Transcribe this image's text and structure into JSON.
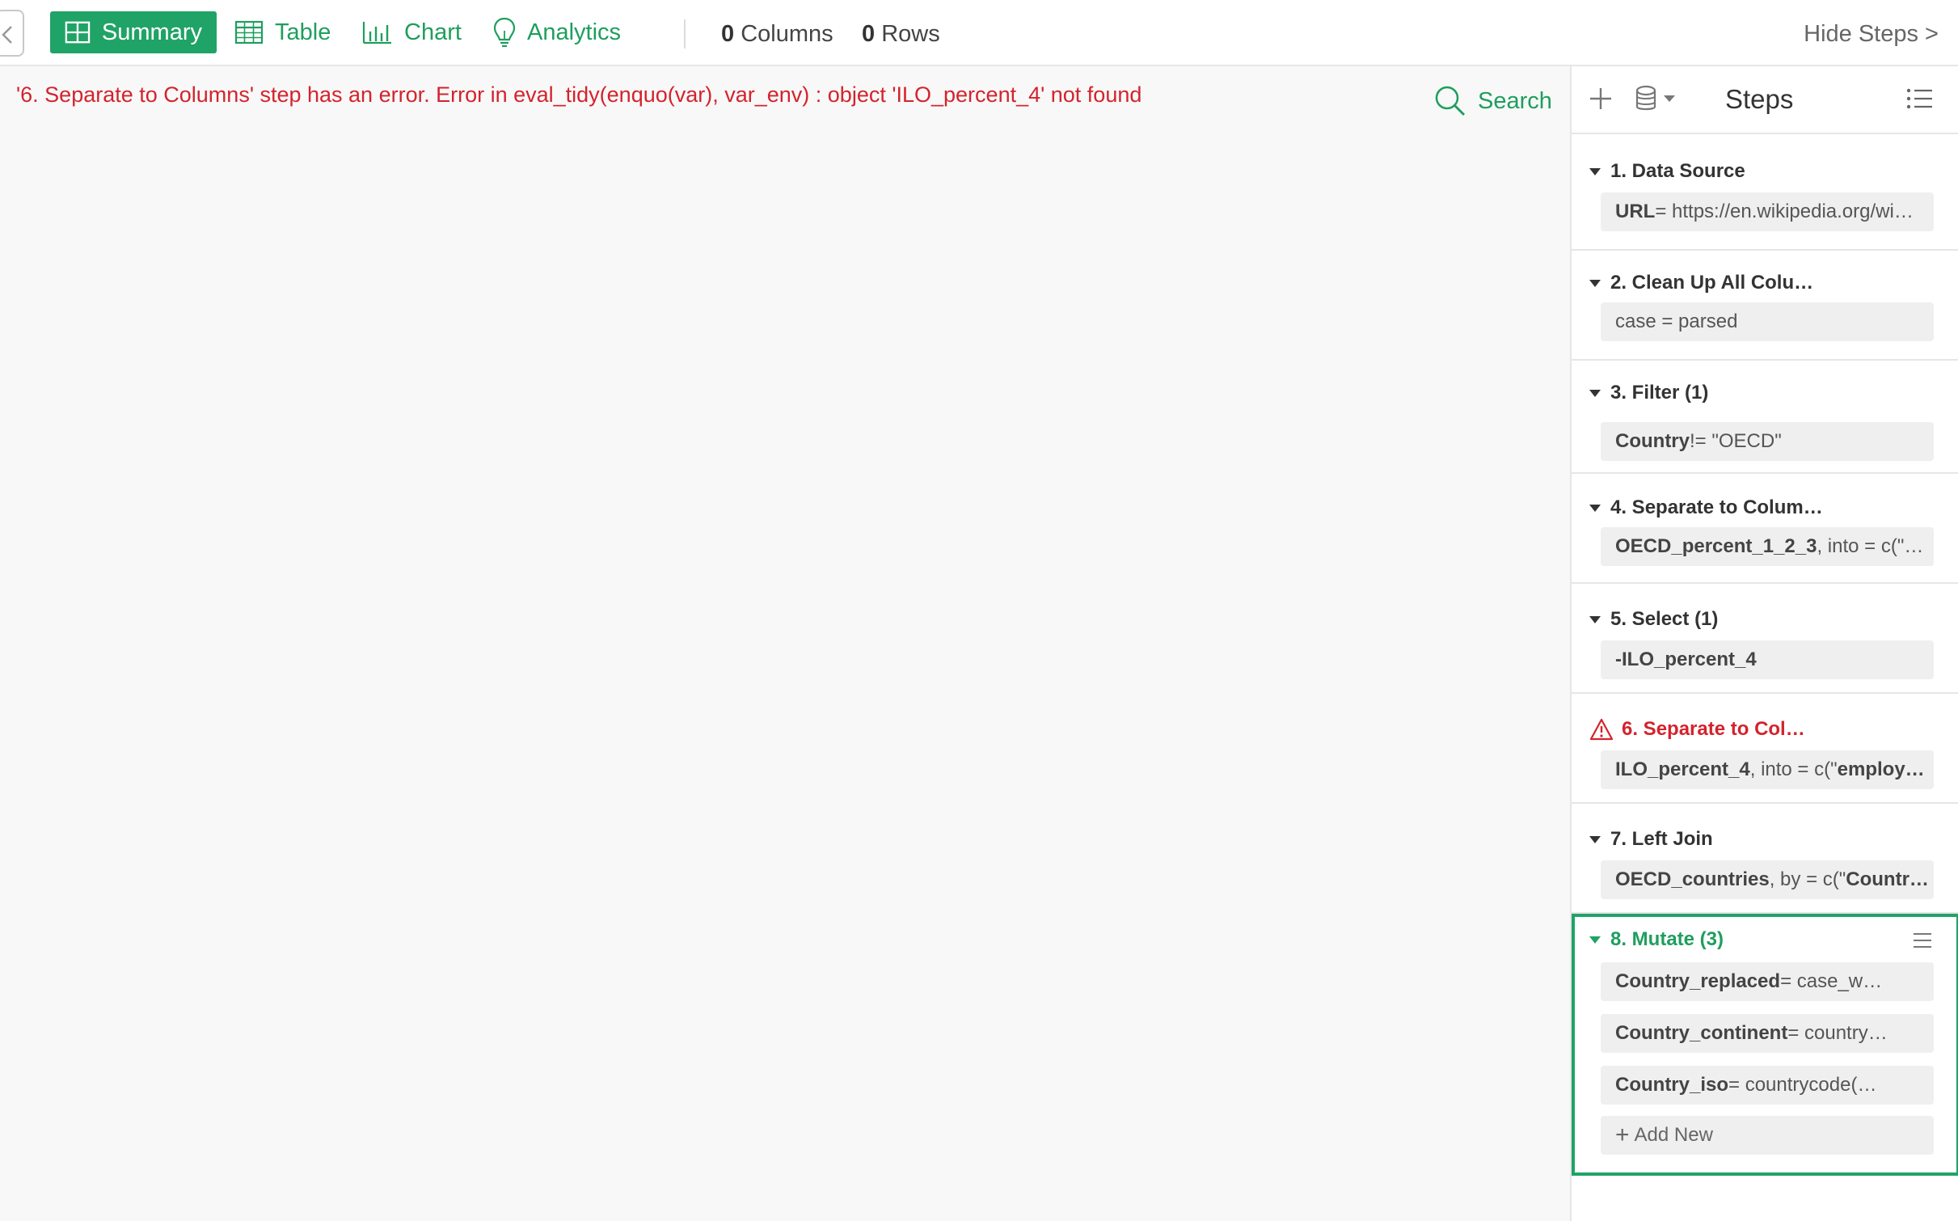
{
  "toolbar": {
    "tabs": [
      {
        "label": "Summary",
        "icon": "summary-grid-icon",
        "active": true
      },
      {
        "label": "Table",
        "icon": "table-icon",
        "active": false
      },
      {
        "label": "Chart",
        "icon": "bar-chart-icon",
        "active": false
      },
      {
        "label": "Analytics",
        "icon": "lightbulb-icon",
        "active": false
      }
    ],
    "columns_count": "0",
    "columns_label": "Columns",
    "rows_count": "0",
    "rows_label": "Rows",
    "hide_steps": "Hide Steps >"
  },
  "main": {
    "error_message": "'6. Separate to Columns' step has an error. Error in eval_tidy(enquo(var), var_env) : object 'ILO_percent_4' not found",
    "search_label": "Search"
  },
  "steps_panel": {
    "title": "Steps",
    "steps": [
      {
        "title": "1. Data Source",
        "body_bold": "URL",
        "body_rest": " = https://en.wikipedia.org/wi…"
      },
      {
        "title": "2. Clean Up All Colu…",
        "body_bold": "",
        "body_rest": "case = parsed"
      },
      {
        "title": "3. Filter (1)",
        "body_bold": "Country",
        "body_rest": " != \"OECD\""
      },
      {
        "title": "4. Separate to Colum…",
        "body_bold": "OECD_percent_1_2_3",
        "body_rest": ", into = c(\"…"
      },
      {
        "title": "5. Select (1)",
        "body_bold": "-ILO_percent_4",
        "body_rest": ""
      },
      {
        "title": "6. Separate to Col…",
        "body_bold": "ILO_percent_4",
        "body_rest": ", into = c(\"",
        "body_bold2": "employ…",
        "status": "error"
      },
      {
        "title": "7. Left Join",
        "body_bold": "OECD_countries",
        "body_rest": ", by = c(\"",
        "body_bold2": "Countr…"
      },
      {
        "title": "8. Mutate (3)",
        "status": "active",
        "items": [
          {
            "bold": "Country_replaced",
            "rest": " = case_w…"
          },
          {
            "bold": "Country_continent",
            "rest": " = country…"
          },
          {
            "bold": "Country_iso",
            "rest": " = countrycode(…"
          }
        ],
        "add_new": "Add New"
      }
    ]
  },
  "colors": {
    "accent": "#20a366",
    "error": "#d4232c"
  }
}
